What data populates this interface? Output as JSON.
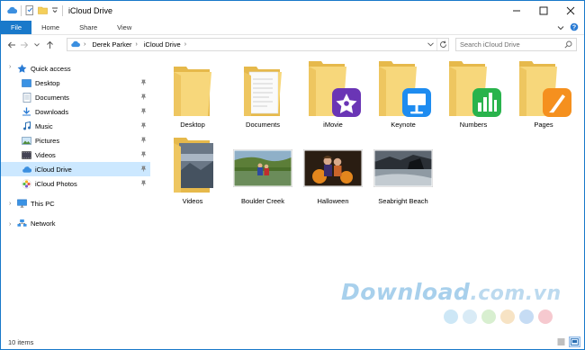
{
  "window": {
    "title": "iCloud Drive",
    "accent": "#1979ca"
  },
  "ribbon": {
    "tabs": [
      "File",
      "Home",
      "Share",
      "View"
    ]
  },
  "address": {
    "crumbs": [
      "Derek Parker",
      "iCloud Drive"
    ]
  },
  "search": {
    "placeholder": "Search iCloud Drive"
  },
  "nav": {
    "quick_access": "Quick access",
    "items": [
      {
        "label": "Desktop",
        "icon": "desktop-icon",
        "pinned": true
      },
      {
        "label": "Documents",
        "icon": "documents-icon",
        "pinned": true
      },
      {
        "label": "Downloads",
        "icon": "downloads-icon",
        "pinned": true
      },
      {
        "label": "Music",
        "icon": "music-icon",
        "pinned": true
      },
      {
        "label": "Pictures",
        "icon": "pictures-icon",
        "pinned": true
      },
      {
        "label": "Videos",
        "icon": "videos-icon",
        "pinned": true
      },
      {
        "label": "iCloud Drive",
        "icon": "icloud-icon",
        "pinned": true,
        "selected": true
      },
      {
        "label": "iCloud Photos",
        "icon": "icloud-photos-icon",
        "pinned": true
      }
    ],
    "this_pc": "This PC",
    "network": "Network"
  },
  "content": {
    "folders": [
      {
        "label": "Desktop",
        "badge": "none"
      },
      {
        "label": "Documents",
        "badge": "documents"
      },
      {
        "label": "iMovie",
        "badge": "imovie"
      },
      {
        "label": "Keynote",
        "badge": "keynote"
      },
      {
        "label": "Numbers",
        "badge": "numbers"
      },
      {
        "label": "Pages",
        "badge": "pages"
      },
      {
        "label": "Videos",
        "badge": "videos"
      }
    ],
    "photos": [
      {
        "label": "Boulder Creek"
      },
      {
        "label": "Halloween"
      },
      {
        "label": "Seabright Beach"
      }
    ]
  },
  "status": {
    "item_count": "10 items"
  },
  "watermark": {
    "brand": "Download",
    "tld": ".com.vn",
    "dot_colors": [
      "#cde7f6",
      "#d9ebf6",
      "#d8efd0",
      "#f7e3c4",
      "#c6dcf4",
      "#f6c9cf"
    ]
  }
}
